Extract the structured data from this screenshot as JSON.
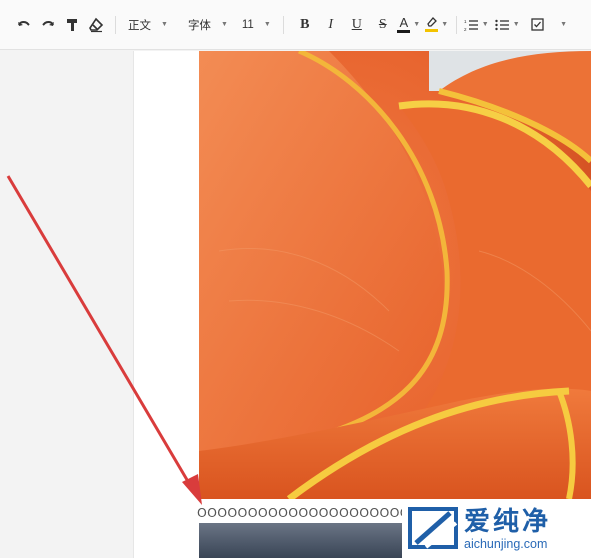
{
  "toolbar": {
    "style_select": "正文",
    "font_select": "字体",
    "size_select": "11",
    "bold": "B",
    "italic": "I",
    "underline": "U",
    "strike": "S",
    "text_color": "A",
    "colors": {
      "text_color_bar": "#1a1a1a",
      "highlight_bar": "#f3c300"
    },
    "icons": [
      "undo-icon",
      "redo-icon",
      "paint-format-icon",
      "clear-format-icon",
      "highlight-icon",
      "numbered-list-icon",
      "bulleted-list-icon",
      "checklist-icon"
    ]
  },
  "document": {
    "text_line": "OOOOOOOOOOOOOOOOOOOOOO"
  },
  "watermark": {
    "chinese": "爱纯净",
    "url": "aichunjing.com",
    "color": "#1f5fa8"
  },
  "annotation": {
    "arrow_color": "#d93c3c"
  }
}
